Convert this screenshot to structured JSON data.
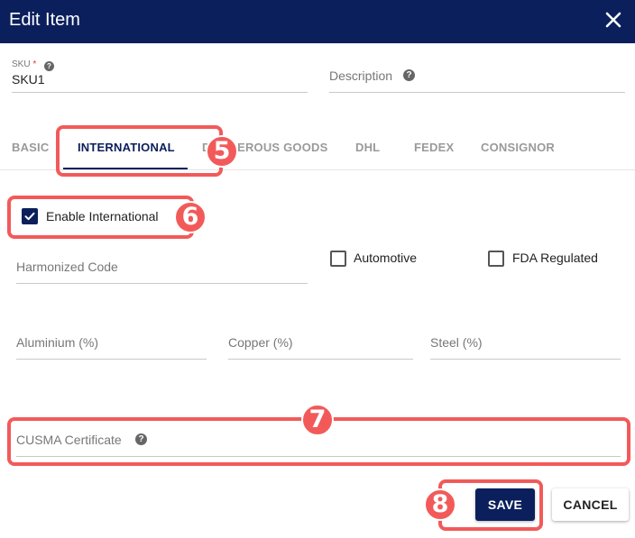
{
  "dialog": {
    "title": "Edit Item"
  },
  "fields": {
    "sku": {
      "label": "SKU",
      "required_mark": "*",
      "value": "SKU1"
    },
    "description": {
      "label": "Description"
    },
    "harmonized_code": {
      "label": "Harmonized Code"
    },
    "aluminium": {
      "label": "Aluminium (%)"
    },
    "copper": {
      "label": "Copper (%)"
    },
    "steel": {
      "label": "Steel (%)"
    },
    "cusma": {
      "label": "CUSMA Certificate"
    }
  },
  "help_icon_glyph": "?",
  "tabs": [
    {
      "label": "BASIC",
      "active": false
    },
    {
      "label": "INTERNATIONAL",
      "active": true
    },
    {
      "label": "DANGEROUS GOODS",
      "active": false
    },
    {
      "label": "DHL",
      "active": false
    },
    {
      "label": "FEDEX",
      "active": false
    },
    {
      "label": "CONSIGNOR",
      "active": false
    }
  ],
  "checkboxes": {
    "enable_international": {
      "label": "Enable International",
      "checked": true
    },
    "automotive": {
      "label": "Automotive",
      "checked": false
    },
    "fda_regulated": {
      "label": "FDA Regulated",
      "checked": false
    }
  },
  "buttons": {
    "save": "SAVE",
    "cancel": "CANCEL"
  },
  "annotations": {
    "step_5": "5",
    "step_6": "6",
    "step_7": "7",
    "step_8": "8"
  },
  "colors": {
    "primary": "#0b1f5c",
    "highlight": "#f25a5a"
  },
  "icons": [
    "close-icon",
    "help-icon",
    "check-icon"
  ]
}
